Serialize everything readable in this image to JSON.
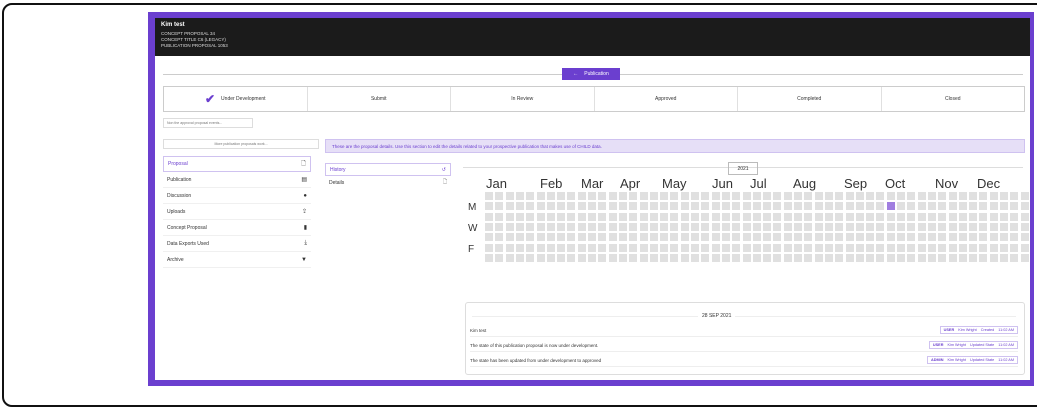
{
  "header": {
    "name": "Kim test",
    "lines": [
      "CONCEPT PROPOSAL 34",
      "CONCEPT TITLE C6 (LEGACY)",
      "PUBLICATION PROPOSAL 1053"
    ]
  },
  "publication_button": {
    "label": "Publication",
    "icon": "arrow-left-icon"
  },
  "steps": [
    "Under Development",
    "Submit",
    "In Review",
    "Approved",
    "Completed",
    "Closed"
  ],
  "approval_note": "Non the approval proposal events...",
  "left_note": "More publication proposals work...",
  "banner_text": "These are the proposal details. Use this section to edit the details related to your prospective publication that makes use of CHILD data.",
  "nav": [
    {
      "label": "Proposal",
      "icon": "file-icon"
    },
    {
      "label": "Publication",
      "icon": "book-icon"
    },
    {
      "label": "Discussion",
      "icon": "comment-icon"
    },
    {
      "label": "Uploads",
      "icon": "upload-icon"
    },
    {
      "label": "Concept Proposal",
      "icon": "document-icon"
    },
    {
      "label": "Data Exports Used",
      "icon": "download-icon"
    },
    {
      "label": "Archive",
      "icon": "trash-icon"
    }
  ],
  "subnav": [
    {
      "label": "History",
      "icon": "history-icon"
    },
    {
      "label": "Details",
      "icon": "file-icon"
    }
  ],
  "calendar": {
    "year": "2021",
    "months": [
      "Jan",
      "Feb",
      "Mar",
      "Apr",
      "May",
      "Jun",
      "Jul",
      "Aug",
      "Sep",
      "Oct",
      "Nov",
      "Dec"
    ],
    "day_labels": [
      "M",
      "W",
      "F"
    ],
    "active_cell": {
      "week": 39,
      "day": 1
    },
    "accent_color": "#a07ee0"
  },
  "log": {
    "date": "28 SEP 2021",
    "entries": [
      {
        "text": "Kim test",
        "role": "USER",
        "user": "Kim Wright",
        "action": "Created",
        "time": "11:02 AM"
      },
      {
        "text": "The state of this publication proposal is now under development.",
        "role": "USER",
        "user": "Kim Wright",
        "action": "Updated State",
        "time": "11:02 AM"
      },
      {
        "text": "The state has been updated from under development to approved",
        "role": "ADMIN",
        "user": "Kim Wright",
        "action": "Updated State",
        "time": "11:02 AM"
      }
    ]
  },
  "colors": {
    "accent": "#6b3fcf",
    "header_bg": "#1b1b1b"
  }
}
